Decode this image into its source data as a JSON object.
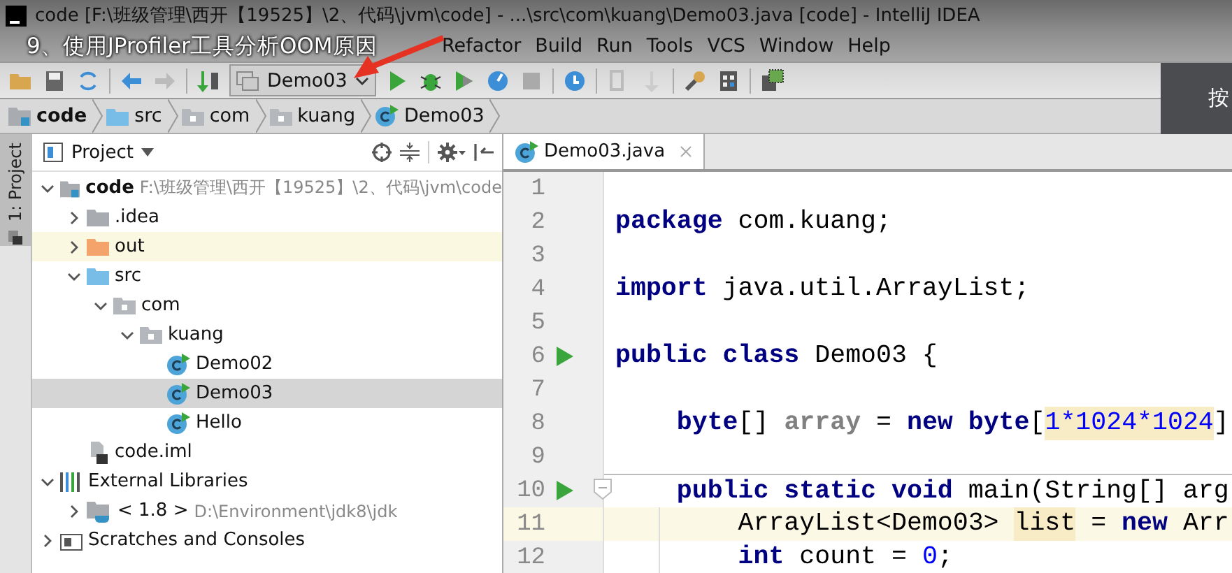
{
  "window": {
    "title": "code [F:\\班级管理\\西开【19525】\\2、代码\\jvm\\code] - ...\\src\\com\\kuang\\Demo03.java [code] - IntelliJ IDEA"
  },
  "menu": [
    "Refactor",
    "Build",
    "Run",
    "Tools",
    "VCS",
    "Window",
    "Help"
  ],
  "toolbar": {
    "run_config": "Demo03"
  },
  "side_panel": {
    "text": "按"
  },
  "breadcrumbs": [
    {
      "label": "code",
      "kind": "module"
    },
    {
      "label": "src",
      "kind": "source"
    },
    {
      "label": "com",
      "kind": "package"
    },
    {
      "label": "kuang",
      "kind": "package"
    },
    {
      "label": "Demo03",
      "kind": "class"
    }
  ],
  "tool_strip": {
    "label": "1: Project",
    "selected": true
  },
  "project": {
    "title": "Project",
    "tree": [
      {
        "label": "code",
        "detail": "F:\\班级管理\\西开【19525】\\2、代码\\jvm\\code",
        "kind": "module",
        "expanded": true,
        "selected": false,
        "children": [
          {
            "label": ".idea",
            "kind": "folder",
            "expanded": false,
            "selected": false
          },
          {
            "label": "out",
            "kind": "excluded",
            "expanded": false,
            "selected": false
          },
          {
            "label": "src",
            "kind": "source",
            "expanded": true,
            "selected": false,
            "children": [
              {
                "label": "com",
                "kind": "package",
                "expanded": true,
                "selected": false,
                "children": [
                  {
                    "label": "kuang",
                    "kind": "package",
                    "expanded": true,
                    "selected": false,
                    "children": [
                      {
                        "label": "Demo02",
                        "kind": "class",
                        "selected": false
                      },
                      {
                        "label": "Demo03",
                        "kind": "class",
                        "selected": true
                      },
                      {
                        "label": "Hello",
                        "kind": "class",
                        "selected": false
                      }
                    ]
                  }
                ]
              }
            ]
          },
          {
            "label": "code.iml",
            "kind": "file",
            "selected": false
          }
        ]
      },
      {
        "label": "External Libraries",
        "kind": "libraries",
        "expanded": true,
        "selected": false,
        "children": [
          {
            "label": "< 1.8 >",
            "detail": "D:\\Environment\\jdk8\\jdk",
            "kind": "sdk",
            "expanded": false,
            "selected": false
          }
        ]
      },
      {
        "label": "Scratches and Consoles",
        "kind": "scratches",
        "expanded": false,
        "selected": false
      }
    ]
  },
  "editor": {
    "tabs": [
      {
        "label": "Demo03.java",
        "selected": true
      }
    ],
    "lines": [
      {
        "number": "1"
      },
      {
        "number": "2",
        "tokens": [
          {
            "text": "package",
            "kind": "keyword"
          },
          {
            "text": " com.kuang;",
            "kind": "plain"
          }
        ]
      },
      {
        "number": "3"
      },
      {
        "number": "4",
        "tokens": [
          {
            "text": "import",
            "kind": "keyword"
          },
          {
            "text": " java.util.ArrayList;",
            "kind": "plain"
          }
        ]
      },
      {
        "number": "5"
      },
      {
        "number": "6",
        "run": true,
        "tokens": [
          {
            "text": "public class",
            "kind": "keyword"
          },
          {
            "text": " Demo03 {",
            "kind": "plain"
          }
        ]
      },
      {
        "number": "7"
      },
      {
        "number": "8",
        "tokens": [
          {
            "text": "    byte",
            "kind": "keyword"
          },
          {
            "text": "[] ",
            "kind": "plain"
          },
          {
            "text": "array",
            "kind": "field"
          },
          {
            "text": " = ",
            "kind": "plain"
          },
          {
            "text": "new byte",
            "kind": "keyword"
          },
          {
            "text": "[",
            "kind": "plain"
          },
          {
            "text": "1*1024*1024",
            "kind": "number",
            "highlight": true
          },
          {
            "text": "]",
            "kind": "plain"
          }
        ]
      },
      {
        "number": "9"
      },
      {
        "number": "10",
        "run": true,
        "fold": true,
        "separator": true,
        "tokens": [
          {
            "text": "    public static void",
            "kind": "keyword"
          },
          {
            "text": " main(String[] arg",
            "kind": "plain"
          }
        ]
      },
      {
        "number": "11",
        "current": true,
        "tokens": [
          {
            "text": "        ArrayList<Demo03> ",
            "kind": "plain"
          },
          {
            "text": "list",
            "kind": "plain",
            "highlight": true
          },
          {
            "text": " = ",
            "kind": "plain"
          },
          {
            "text": "new",
            "kind": "keyword"
          },
          {
            "text": " Arr",
            "kind": "plain"
          }
        ]
      },
      {
        "number": "12",
        "tokens": [
          {
            "text": "        int",
            "kind": "keyword"
          },
          {
            "text": " count = ",
            "kind": "plain"
          },
          {
            "text": "0",
            "kind": "number"
          },
          {
            "text": ";",
            "kind": "plain"
          }
        ]
      }
    ]
  },
  "overlay": {
    "caption": "9、使用JProfiler工具分析OOM原因"
  }
}
